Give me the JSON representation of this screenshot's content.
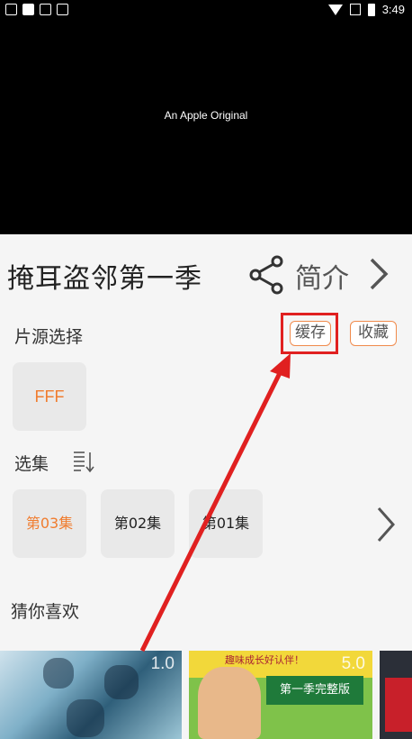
{
  "status_bar": {
    "time": "3:49"
  },
  "video": {
    "caption": "An Apple Original"
  },
  "show": {
    "title": "掩耳盗邻第一季",
    "intro_label": "简介"
  },
  "source": {
    "label": "片源选择",
    "cache_label": "缓存",
    "favorite_label": "收藏",
    "options": [
      "FFF"
    ]
  },
  "episodes": {
    "label": "选集",
    "items": [
      "第03集",
      "第02集",
      "第01集"
    ]
  },
  "recommend": {
    "label": "猜你喜欢",
    "items": [
      {
        "score": "1.0"
      },
      {
        "score": "5.0",
        "top_text": "趣味成长好认伴！",
        "banner": "第一季完整版"
      }
    ]
  },
  "colors": {
    "accent": "#f07c2e",
    "highlight": "#e02020"
  }
}
